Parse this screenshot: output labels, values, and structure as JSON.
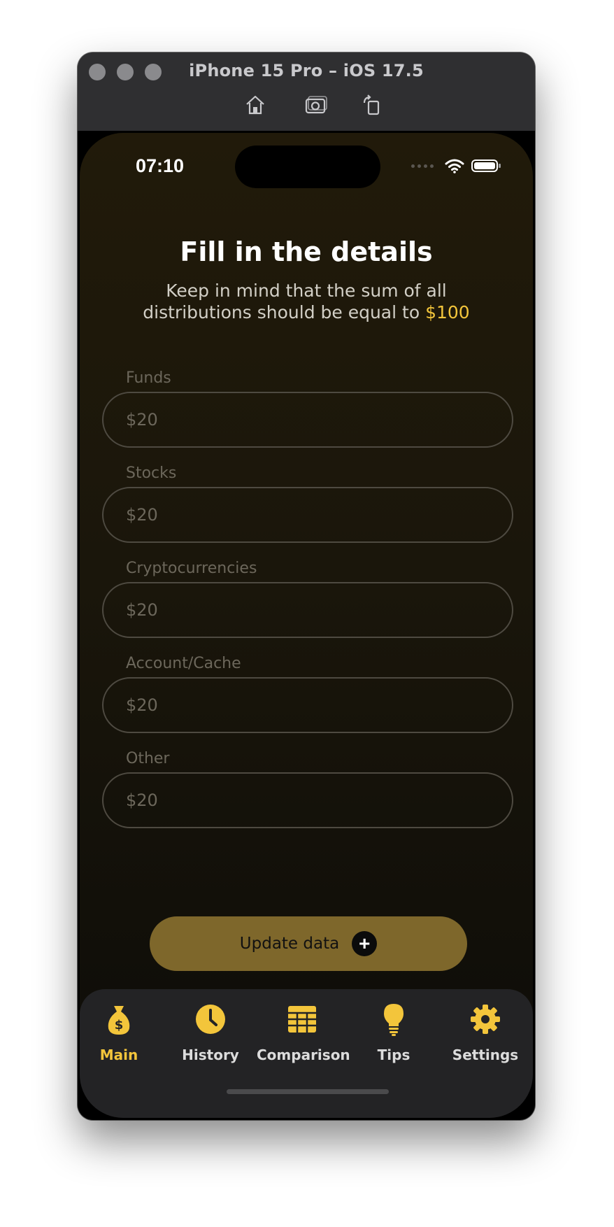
{
  "simulator": {
    "title": "iPhone 15 Pro – iOS 17.5",
    "toolbar_icons": [
      "home-icon",
      "screenshot-icon",
      "rotate-icon"
    ]
  },
  "status_bar": {
    "time": "07:10",
    "icons": [
      "cellular-icon",
      "wifi-icon",
      "battery-icon"
    ]
  },
  "main": {
    "title": "Fill in the details",
    "subtitle_text": "Keep in mind that the sum of all distributions should be equal to",
    "subtitle_amount": "$100",
    "fields": [
      {
        "label": "Funds",
        "placeholder": "$20"
      },
      {
        "label": "Stocks",
        "placeholder": "$20"
      },
      {
        "label": "Cryptocurrencies",
        "placeholder": "$20"
      },
      {
        "label": "Account/Cache",
        "placeholder": "$20"
      },
      {
        "label": "Other",
        "placeholder": "$20"
      }
    ],
    "update_button": {
      "label": "Update data",
      "icon": "plus-icon"
    }
  },
  "tabbar": {
    "tabs": [
      {
        "label": "Main",
        "icon": "money-bag-icon",
        "active": true
      },
      {
        "label": "History",
        "icon": "clock-icon",
        "active": false
      },
      {
        "label": "Comparison",
        "icon": "table-icon",
        "active": false
      },
      {
        "label": "Tips",
        "icon": "lightbulb-icon",
        "active": false
      },
      {
        "label": "Settings",
        "icon": "gear-icon",
        "active": false
      }
    ]
  },
  "colors": {
    "accent": "#f3c53b",
    "button": "#7e672b",
    "tabbar": "#232325"
  }
}
